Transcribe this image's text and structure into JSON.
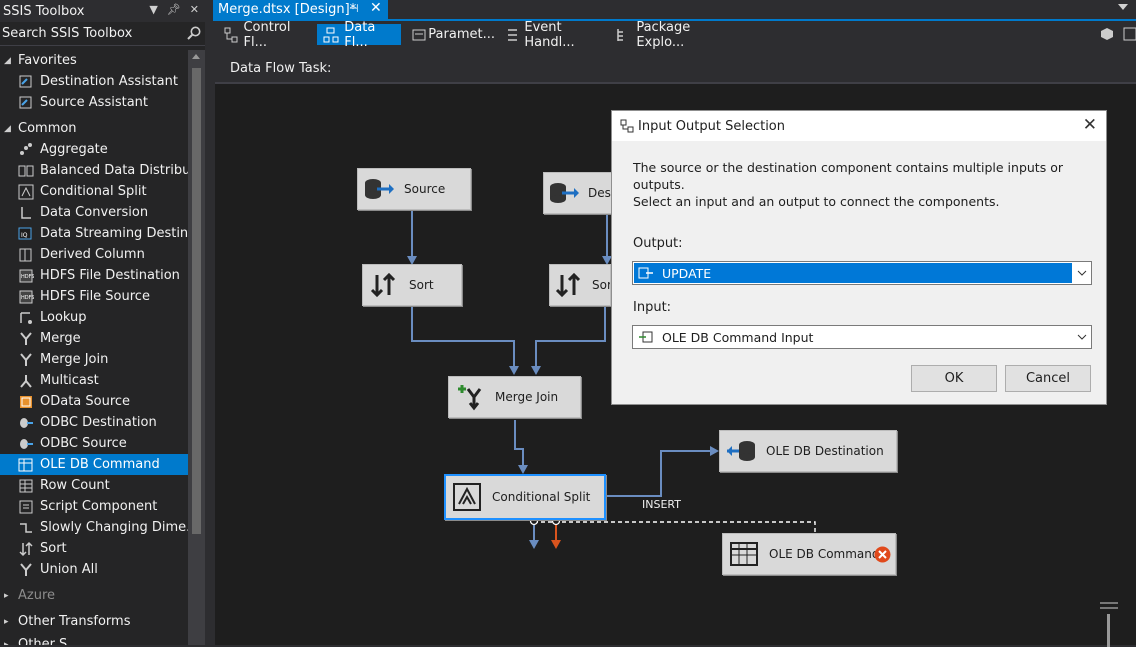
{
  "toolbox": {
    "title": "SSIS Toolbox",
    "search_label": "Search SSIS Toolbox",
    "groups": [
      {
        "label": "Favorites",
        "items": [
          "Destination Assistant",
          "Source Assistant"
        ]
      },
      {
        "label": "Common",
        "items": [
          "Aggregate",
          "Balanced Data Distribu...",
          "Conditional Split",
          "Data Conversion",
          "Data Streaming Destin...",
          "Derived Column",
          "HDFS File Destination",
          "HDFS File Source",
          "Lookup",
          "Merge",
          "Merge Join",
          "Multicast",
          "OData Source",
          "ODBC Destination",
          "ODBC Source",
          "OLE DB Command",
          "Row Count",
          "Script Component",
          "Slowly Changing Dime...",
          "Sort",
          "Union All"
        ]
      },
      {
        "label": "Azure",
        "items": []
      },
      {
        "label": "Other Transforms",
        "items": []
      },
      {
        "label": "Other S...",
        "items": []
      }
    ],
    "selected_item": "OLE DB Command"
  },
  "document": {
    "tab_title": "Merge.dtsx [Design]*",
    "tabs": [
      "Control Fl...",
      "Data Fl...",
      "Paramet...",
      "Event Handl...",
      "Package Explo..."
    ],
    "active_tab": "Data Fl...",
    "task_label": "Data Flow Task:"
  },
  "canvas": {
    "nodes": {
      "source": "Source",
      "design": "Design",
      "sort1": "Sort",
      "sort2": "Sort",
      "merge_join": "Merge Join",
      "conditional_split": "Conditional Split",
      "ole_db_destination": "OLE DB Destination",
      "ole_db_command": "OLE DB Command"
    },
    "path_label": "INSERT"
  },
  "dialog": {
    "title": "Input Output Selection",
    "message_line1": "The source or the destination component contains multiple inputs or outputs.",
    "message_line2": "Select an input and an output to connect the components.",
    "output_label": "Output:",
    "output_value": "UPDATE",
    "input_label": "Input:",
    "input_value": "OLE DB Command Input",
    "ok": "OK",
    "cancel": "Cancel"
  },
  "colors": {
    "accent": "#007acc",
    "selection": "#0078d7",
    "error": "#e0491b"
  }
}
